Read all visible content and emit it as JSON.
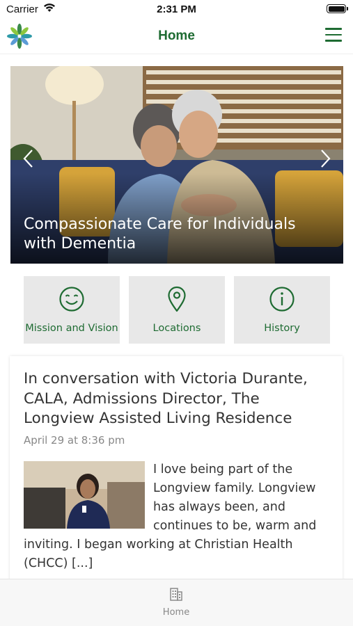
{
  "status_bar": {
    "carrier": "Carrier",
    "time": "2:31 PM"
  },
  "nav": {
    "title": "Home",
    "logo_icon": "flower-logo-icon",
    "menu_icon": "hamburger-menu-icon"
  },
  "hero": {
    "caption": "Compassionate Care for Individuals with Dementia",
    "prev_icon": "chevron-left-icon",
    "next_icon": "chevron-right-icon"
  },
  "tiles": [
    {
      "label": "Mission and Vision",
      "icon": "smiley-face-icon"
    },
    {
      "label": "Locations",
      "icon": "map-pin-icon"
    },
    {
      "label": "History",
      "icon": "info-circle-icon"
    }
  ],
  "article": {
    "title": "In conversation with Victoria Durante, CALA, Admissions Director, The Longview Assisted Living Residence",
    "date": "April 29 at 8:36 pm",
    "excerpt": "I love being part of the Longview family. Longview has always been, and continues to be, warm and inviting. I began working at Christian Health (CHCC) [...]"
  },
  "tab_bar": {
    "items": [
      {
        "label": "Home",
        "icon": "building-icon"
      }
    ]
  },
  "colors": {
    "brand_green": "#1e6b32",
    "tile_bg": "#e8e8e8",
    "muted_text": "#888888"
  }
}
